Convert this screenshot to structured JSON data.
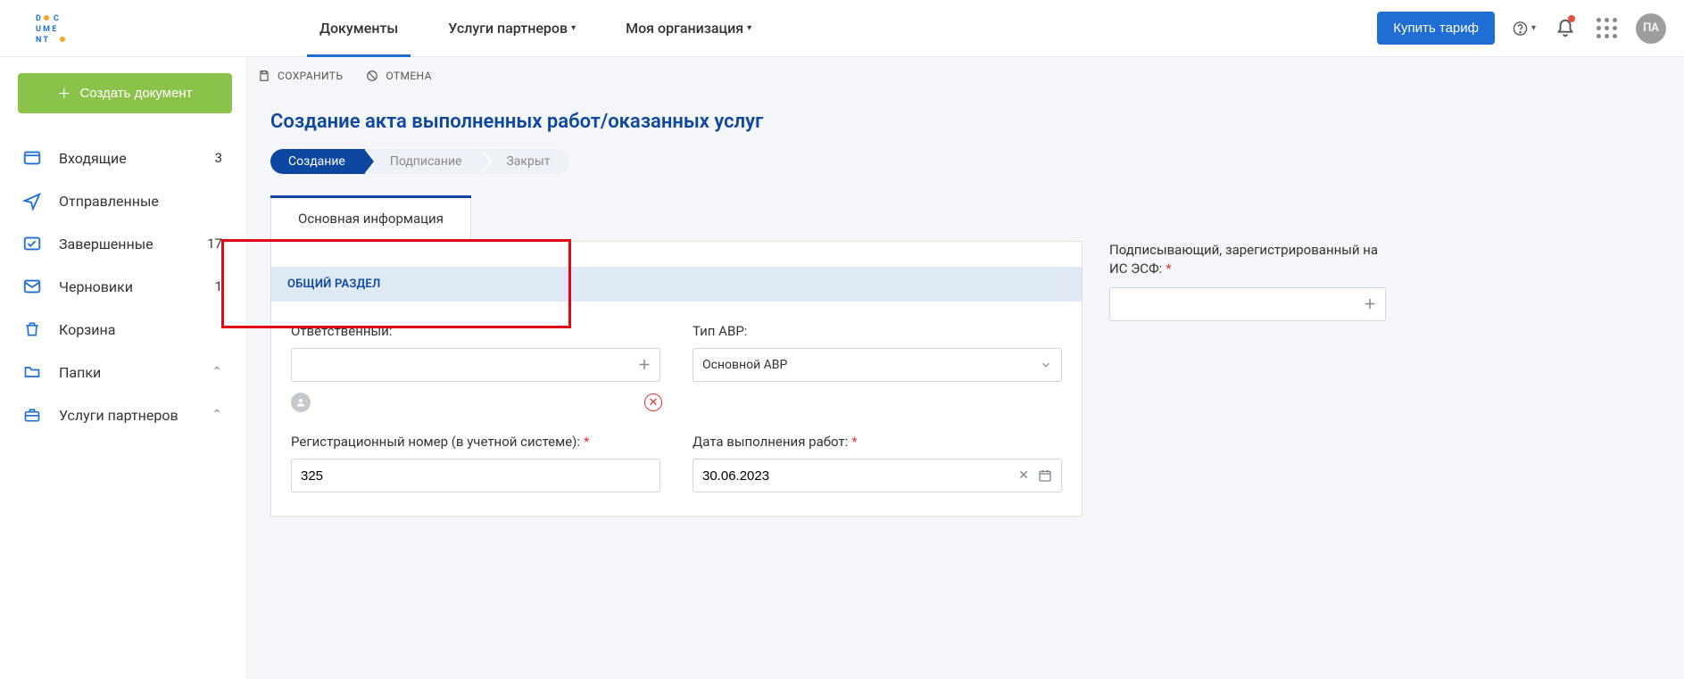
{
  "header": {
    "nav": {
      "documents": "Документы",
      "partners": "Услуги партнеров",
      "org": "Моя организация"
    },
    "buy": "Купить тариф",
    "avatar": "ПА"
  },
  "sidebar": {
    "create": "Создать документ",
    "items": [
      {
        "label": "Входящие",
        "count": "3"
      },
      {
        "label": "Отправленные",
        "count": ""
      },
      {
        "label": "Завершенные",
        "count": "17"
      },
      {
        "label": "Черновики",
        "count": "1"
      },
      {
        "label": "Корзина",
        "count": ""
      },
      {
        "label": "Папки",
        "count": ""
      },
      {
        "label": "Услуги партнеров",
        "count": ""
      }
    ]
  },
  "toolbar": {
    "save": "СОХРАНИТЬ",
    "cancel": "ОТМЕНА"
  },
  "page": {
    "title": "Создание акта выполненных работ/оказанных услуг"
  },
  "steps": {
    "s1": "Создание",
    "s2": "Подписание",
    "s3": "Закрыт"
  },
  "tabs": {
    "main": "Основная информация"
  },
  "section": {
    "general": "ОБЩИЙ РАЗДЕЛ"
  },
  "fields": {
    "responsible_label": "Ответственный:",
    "avr_type_label": "Тип АВР:",
    "avr_type_value": "Основной АВР",
    "reg_num_label": "Регистрационный номер (в учетной системе):",
    "reg_num_value": "325",
    "work_date_label": "Дата выполнения работ:",
    "work_date_value": "30.06.2023",
    "signer_label": "Подписывающий, зарегистрированный на ИС ЭСФ:"
  }
}
